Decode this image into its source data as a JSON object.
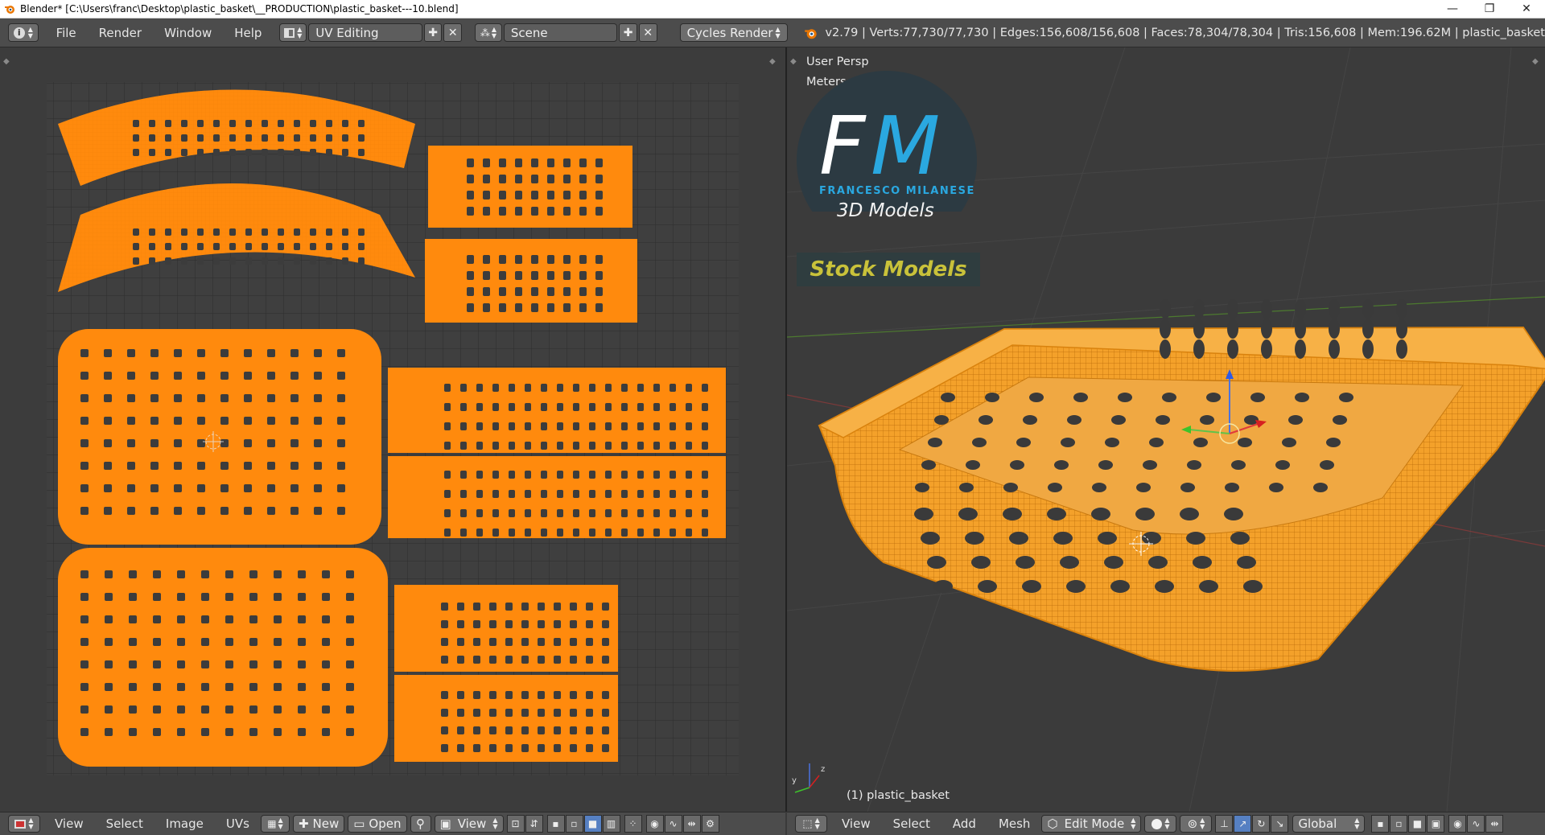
{
  "window": {
    "title": "Blender* [C:\\Users\\franc\\Desktop\\plastic_basket\\__PRODUCTION\\plastic_basket---10.blend]",
    "controls": [
      "—",
      "❐",
      "✕"
    ]
  },
  "header": {
    "menus": [
      "File",
      "Render",
      "Window",
      "Help"
    ],
    "screen_layout": "UV Editing",
    "scene": "Scene",
    "render_engine": "Cycles Render",
    "stats": "v2.79 | Verts:77,730/77,730 | Edges:156,608/156,608 | Faces:78,304/78,304 | Tris:156,608 | Mem:196.62M | plastic_basket"
  },
  "uv_editor": {
    "menus": [
      "View",
      "Select",
      "Image",
      "UVs"
    ],
    "new_label": "New",
    "open_label": "Open",
    "view_label": "View"
  },
  "viewport": {
    "view_name": "User Persp",
    "units": "Meters",
    "object_label": "(1) plastic_basket",
    "menus": [
      "View",
      "Select",
      "Add",
      "Mesh"
    ],
    "mode": "Edit Mode",
    "orientation": "Global"
  },
  "logo": {
    "letters": "FM",
    "name": "FRANCESCO MILANESE",
    "subtitle": "3D Models",
    "tagline": "Stock Models"
  },
  "colors": {
    "uv_island": "#ff8a0d",
    "mesh_orange": "#f59a1a",
    "logo_blue": "#2aa8e0",
    "tagline": "#c9c23a",
    "header_bg": "#4c4c4c"
  }
}
